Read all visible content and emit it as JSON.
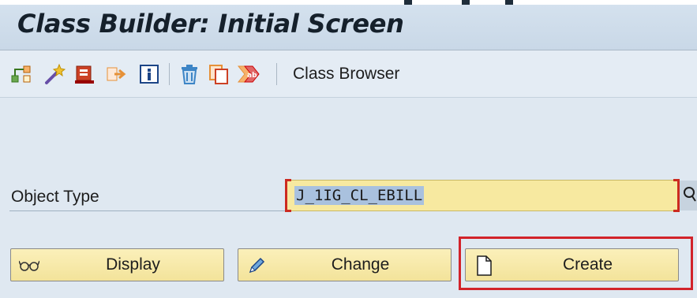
{
  "window": {
    "title": "Class Builder: Initial Screen"
  },
  "toolbar": {
    "icons": [
      "inheritance-hierarchy-icon",
      "wizard-wand-icon",
      "enhance-object-icon",
      "transport-icon",
      "info-icon",
      "delete-icon",
      "copy-icon",
      "rename-icon"
    ],
    "class_browser_label": "Class Browser"
  },
  "form": {
    "object_type_label": "Object Type",
    "object_type_value": "J_1IG_CL_EBILL"
  },
  "buttons": {
    "display_label": "Display",
    "change_label": "Change",
    "create_label": "Create"
  },
  "colors": {
    "title_bar": "#c9d8e7",
    "button_fill": "#f3e39a",
    "input_fill": "#f7e9a0",
    "highlight_border": "#d2232a",
    "required_bracket": "#cc2a20"
  }
}
